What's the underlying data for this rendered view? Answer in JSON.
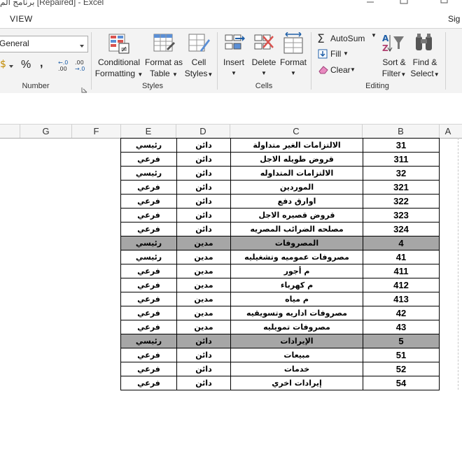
{
  "title": "برنامج الم [Repaired] - Excel",
  "tabs": {
    "view": "VIEW",
    "signin": "Sig"
  },
  "ribbon": {
    "number_format": "General",
    "number_group": "Number",
    "currency_symbol": "$",
    "percent": "%",
    "comma": ",",
    "inc_decimal": "←.0\n.00",
    "dec_decimal": ".00\n→.0",
    "styles_group": "Styles",
    "conditional_formatting": [
      "Conditional",
      "Formatting"
    ],
    "format_as_table": [
      "Format as",
      "Table"
    ],
    "cell_styles": [
      "Cell",
      "Styles"
    ],
    "cells_group": "Cells",
    "insert": "Insert",
    "delete": "Delete",
    "format": "Format",
    "editing_group": "Editing",
    "autosum": "AutoSum",
    "fill": "Fill",
    "clear": "Clear",
    "sort_filter": [
      "Sort &",
      "Filter"
    ],
    "find_select": [
      "Find &",
      "Select"
    ]
  },
  "columns": [
    "G",
    "F",
    "E",
    "D",
    "C",
    "B",
    "A"
  ],
  "rows": [
    {
      "e": "رئيسي",
      "d": "دائن",
      "c": "الالتزامات الغير متداولة",
      "b": "31",
      "hl": false
    },
    {
      "e": "فرعي",
      "d": "دائن",
      "c": "قروض طويله الاجل",
      "b": "311",
      "hl": false
    },
    {
      "e": "رئيسي",
      "d": "دائن",
      "c": "الالتزامات المتداوله",
      "b": "32",
      "hl": false
    },
    {
      "e": "فرعي",
      "d": "دائن",
      "c": "الموردين",
      "b": "321",
      "hl": false
    },
    {
      "e": "فرعي",
      "d": "دائن",
      "c": "اوارق دفع",
      "b": "322",
      "hl": false
    },
    {
      "e": "فرعي",
      "d": "دائن",
      "c": "قروض قصيره الاجل",
      "b": "323",
      "hl": false
    },
    {
      "e": "فرعي",
      "d": "دائن",
      "c": "مصلحه الضرائب المصريه",
      "b": "324",
      "hl": false
    },
    {
      "e": "رئيسي",
      "d": "مدين",
      "c": "المصروفات",
      "b": "4",
      "hl": true
    },
    {
      "e": "رئيسي",
      "d": "مدين",
      "c": "مصروفات عموميه وتشغيليه",
      "b": "41",
      "hl": false
    },
    {
      "e": "فرعي",
      "d": "مدين",
      "c": "م أجور",
      "b": "411",
      "hl": false
    },
    {
      "e": "فرعي",
      "d": "مدين",
      "c": "م كهرباء",
      "b": "412",
      "hl": false
    },
    {
      "e": "فرعي",
      "d": "مدين",
      "c": "م مياه",
      "b": "413",
      "hl": false
    },
    {
      "e": "فرعي",
      "d": "مدين",
      "c": "مصروفات اداريه وتسويقيه",
      "b": "42",
      "hl": false
    },
    {
      "e": "فرعي",
      "d": "مدين",
      "c": "مصروفات تمويليه",
      "b": "43",
      "hl": false
    },
    {
      "e": "رئيسي",
      "d": "دائن",
      "c": "الإيرادات",
      "b": "5",
      "hl": true
    },
    {
      "e": "فرعي",
      "d": "دائن",
      "c": "مبيعات",
      "b": "51",
      "hl": false
    },
    {
      "e": "فرعي",
      "d": "دائن",
      "c": "خدمات",
      "b": "52",
      "hl": false
    },
    {
      "e": "فرعي",
      "d": "دائن",
      "c": "إيرادات اخري",
      "b": "54",
      "hl": false
    }
  ]
}
